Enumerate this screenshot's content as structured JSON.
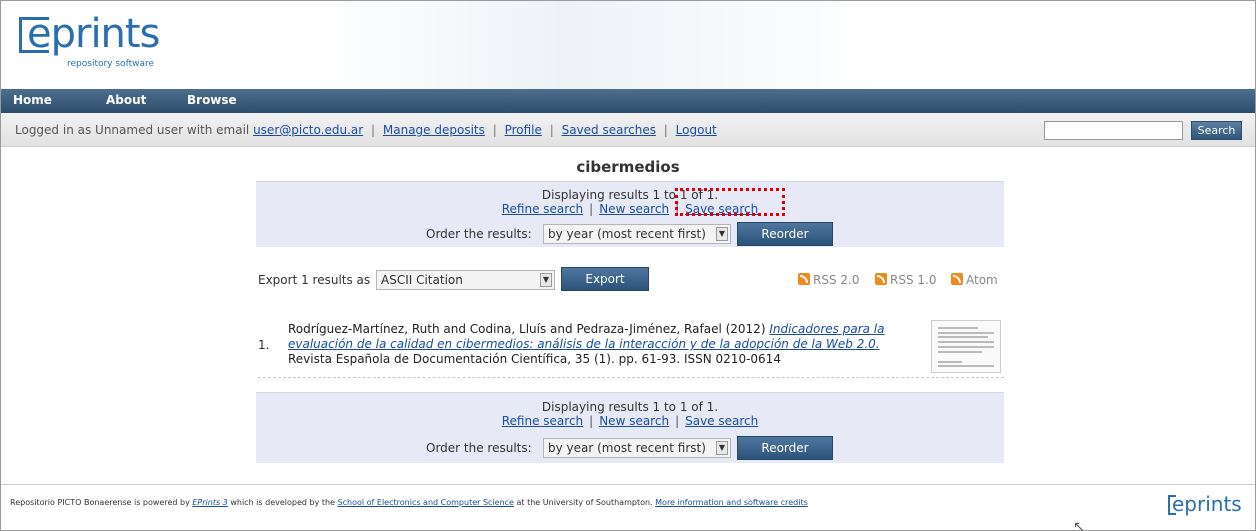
{
  "logo": {
    "text": "eprints",
    "subtitle": "repository software"
  },
  "nav": {
    "items": [
      "Home",
      "About",
      "Browse"
    ]
  },
  "login": {
    "prefix": "Logged in as Unnamed user with email",
    "email": "user@picto.edu.ar",
    "links": [
      "Manage deposits",
      "Profile",
      "Saved searches",
      "Logout"
    ]
  },
  "search": {
    "value": "",
    "button": "Search"
  },
  "page": {
    "title": "cibermedios"
  },
  "top_panel": {
    "displaying": "Displaying results 1 to 1 of 1.",
    "refine": "Refine search",
    "new": "New search",
    "save": "Save search",
    "order_label": "Order the results:",
    "order_value": "by year (most recent first)",
    "reorder": "Reorder"
  },
  "export": {
    "label": "Export 1 results as",
    "format": "ASCII Citation",
    "button": "Export",
    "feeds": [
      "RSS 2.0",
      "RSS 1.0",
      "Atom"
    ]
  },
  "results": [
    {
      "number": "1.",
      "authors": "Rodríguez-Martínez, Ruth and Codina, Lluís and Pedraza-Jiménez, Rafael (2012)",
      "title_line1": "Indicadores para la",
      "title_line2": "evaluación de la calidad en cibermedios: análisis de la interacción y de la adopción de la Web 2.0.",
      "citation": "Revista Española de Documentación Científica, 35 (1). pp. 61-93. ISSN 0210-0614"
    }
  ],
  "bottom_panel": {
    "displaying": "Displaying results 1 to 1 of 1.",
    "refine": "Refine search",
    "new": "New search",
    "save": "Save search",
    "order_label": "Order the results:",
    "order_value": "by year (most recent first)",
    "reorder": "Reorder"
  },
  "footer": {
    "part1": "Repositorio PICTO Bonaerense is powered by",
    "eprints_link": "EPrints 3",
    "part2": "which is developed by the",
    "school_link": "School of Electronics and Computer Science",
    "part3": "at the University of Southampton.",
    "more_link": "More information and software credits",
    "logo": "eprints"
  },
  "colors": {
    "brand": "#2a6eb0",
    "nav": "#2c4d6c",
    "panel": "#e7eaf6",
    "highlight": "#e00000"
  }
}
